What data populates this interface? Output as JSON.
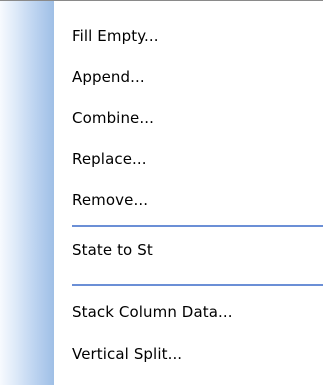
{
  "menu": {
    "items": [
      {
        "label": "Fill Empty..."
      },
      {
        "label": "Append..."
      },
      {
        "label": "Combine..."
      },
      {
        "label": "Replace..."
      },
      {
        "label": "Remove..."
      },
      {
        "label": "State to St"
      },
      {
        "label": "Stack Column Data..."
      },
      {
        "label": "Vertical Split..."
      }
    ]
  },
  "colors": {
    "separator": "#6b8fd6",
    "gutter_dark": "#9fbfe6",
    "gutter_light": "#f7fafe"
  }
}
